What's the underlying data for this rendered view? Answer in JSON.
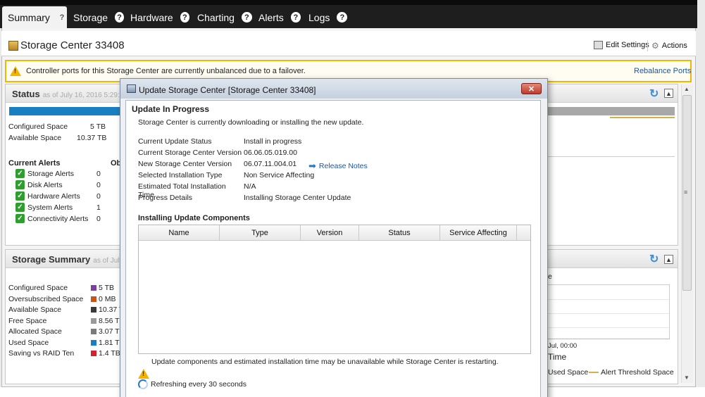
{
  "tabs": [
    {
      "label": "Summary"
    },
    {
      "label": "Storage"
    },
    {
      "label": "Hardware"
    },
    {
      "label": "Charting"
    },
    {
      "label": "Alerts"
    },
    {
      "label": "Logs"
    }
  ],
  "page": {
    "title": "Storage Center 33408",
    "edit_settings": "Edit Settings",
    "actions": "Actions"
  },
  "banner": {
    "text": "Controller ports for this Storage Center are currently unbalanced due to a failover.",
    "link": "Rebalance Ports"
  },
  "status_panel": {
    "title": "Status",
    "as_of": "as of July 16, 2016 5:29:5",
    "configured_label": "Configured Space",
    "configured_value": "5 TB",
    "available_label": "Available Space",
    "available_value": "10.37 TB",
    "alerts_heading": "Current Alerts",
    "obj_heading": "Ob",
    "alerts": [
      {
        "label": "Storage Alerts",
        "count": "0"
      },
      {
        "label": "Disk Alerts",
        "count": "0"
      },
      {
        "label": "Hardware Alerts",
        "count": "0"
      },
      {
        "label": "System Alerts",
        "count": "1"
      },
      {
        "label": "Connectivity Alerts",
        "count": "0"
      }
    ]
  },
  "storage_summary": {
    "title": "Storage Summary",
    "as_of": "as of July",
    "rows": [
      {
        "label": "Configured Space",
        "value": "5 TB",
        "color": "#7b3fa0"
      },
      {
        "label": "Oversubscribed Space",
        "value": "0 MB",
        "color": "#c8541a"
      },
      {
        "label": "Available Space",
        "value": "10.37 T",
        "color": "#3a3a3a"
      },
      {
        "label": "Free Space",
        "value": "8.56 TI",
        "color": "#9a9a9a"
      },
      {
        "label": "Allocated Space",
        "value": "3.07 TI",
        "color": "#7a7a7a"
      },
      {
        "label": "Used Space",
        "value": "1.81 TI",
        "color": "#1a7fc1"
      },
      {
        "label": "Saving vs RAID Ten",
        "value": "1.4 TB",
        "color": "#d4202a"
      }
    ],
    "chart_fragment": {
      "title_tail": "e",
      "x_tick": "Jul, 00:00",
      "x_label": "Time",
      "legend_used": "Used Space",
      "legend_threshold": "Alert Threshold Space",
      "threshold_color": "#d4b24a"
    }
  },
  "dialog": {
    "title": "Update Storage Center [Storage Center 33408]",
    "heading": "Update In Progress",
    "description": "Storage Center is currently downloading or installing the new update.",
    "fields": [
      {
        "label": "Current Update Status",
        "value": "Install in progress"
      },
      {
        "label": "Current Storage Center Version",
        "value": "06.06.05.019.00"
      },
      {
        "label": "New Storage Center Version",
        "value": "06.07.11.004.01"
      },
      {
        "label": "Selected Installation Type",
        "value": "Non Service Affecting"
      },
      {
        "label": "Estimated Total Installation Time",
        "value": "N/A"
      },
      {
        "label": "Progress Details",
        "value": "Installing Storage Center Update"
      }
    ],
    "release_notes": "Release Notes",
    "components_heading": "Installing Update Components",
    "columns": [
      "Name",
      "Type",
      "Version",
      "Status",
      "Service Affecting"
    ],
    "warning": "Update components and estimated installation time may be unavailable while Storage Center is restarting.",
    "refreshing": "Refreshing every 30 seconds"
  },
  "colors": {
    "accent": "#1a7fc1",
    "link": "#1a56a8",
    "warning": "#f0b800"
  }
}
